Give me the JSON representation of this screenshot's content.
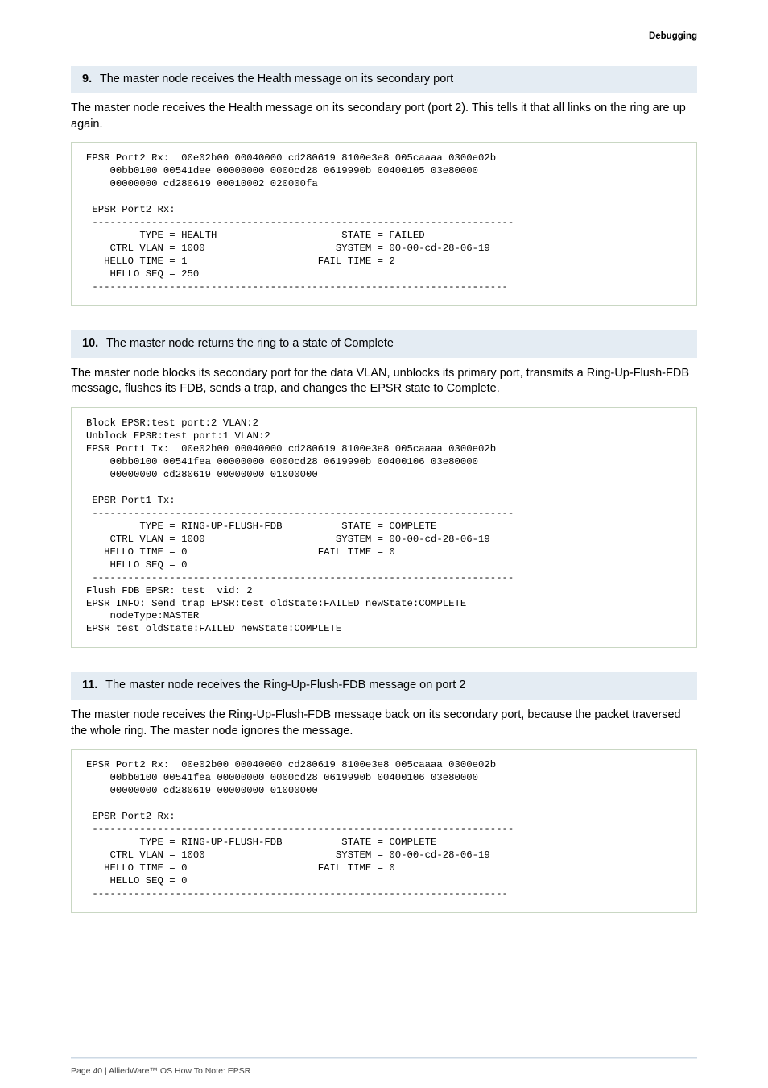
{
  "header": {
    "eyebrow": "Debugging"
  },
  "steps": [
    {
      "num": "9.",
      "title": "The master node receives the Health message on its secondary port",
      "body": "The master node receives the Health message on its secondary port (port 2). This tells it that all links on the ring are up again.",
      "code": "EPSR Port2 Rx:  00e02b00 00040000 cd280619 8100e3e8 005caaaa 0300e02b\n    00bb0100 00541dee 00000000 0000cd28 0619990b 00400105 03e80000\n    00000000 cd280619 00010002 020000fa\n\n EPSR Port2 Rx:\n -----------------------------------------------------------------------\n         TYPE = HEALTH                     STATE = FAILED\n    CTRL VLAN = 1000                      SYSTEM = 00-00-cd-28-06-19\n   HELLO TIME = 1                      FAIL TIME = 2\n    HELLO SEQ = 250\n ----------------------------------------------------------------------"
    },
    {
      "num": "10.",
      "title": "The master node returns the ring to a state of Complete",
      "body": "The master node blocks its secondary port for the data VLAN, unblocks its primary port, transmits a Ring-Up-Flush-FDB message, flushes its FDB, sends a trap, and changes the EPSR state to Complete.",
      "code": "Block EPSR:test port:2 VLAN:2\nUnblock EPSR:test port:1 VLAN:2\nEPSR Port1 Tx:  00e02b00 00040000 cd280619 8100e3e8 005caaaa 0300e02b\n    00bb0100 00541fea 00000000 0000cd28 0619990b 00400106 03e80000\n    00000000 cd280619 00000000 01000000\n\n EPSR Port1 Tx:\n -----------------------------------------------------------------------\n         TYPE = RING-UP-FLUSH-FDB          STATE = COMPLETE\n    CTRL VLAN = 1000                      SYSTEM = 00-00-cd-28-06-19\n   HELLO TIME = 0                      FAIL TIME = 0\n    HELLO SEQ = 0\n -----------------------------------------------------------------------\nFlush FDB EPSR: test  vid: 2\nEPSR INFO: Send trap EPSR:test oldState:FAILED newState:COMPLETE\n    nodeType:MASTER\nEPSR test oldState:FAILED newState:COMPLETE"
    },
    {
      "num": "11.",
      "title": "The master node receives the Ring-Up-Flush-FDB message on port 2",
      "body": "The master node receives the Ring-Up-Flush-FDB message back on its secondary port, because the packet traversed the whole ring. The master node ignores the message.",
      "code": "EPSR Port2 Rx:  00e02b00 00040000 cd280619 8100e3e8 005caaaa 0300e02b\n    00bb0100 00541fea 00000000 0000cd28 0619990b 00400106 03e80000\n    00000000 cd280619 00000000 01000000\n\n EPSR Port2 Rx:\n -----------------------------------------------------------------------\n         TYPE = RING-UP-FLUSH-FDB          STATE = COMPLETE\n    CTRL VLAN = 1000                      SYSTEM = 00-00-cd-28-06-19\n   HELLO TIME = 0                      FAIL TIME = 0\n    HELLO SEQ = 0\n ----------------------------------------------------------------------"
    }
  ],
  "footer": {
    "text": "Page 40 | AlliedWare™ OS How To Note: EPSR"
  }
}
